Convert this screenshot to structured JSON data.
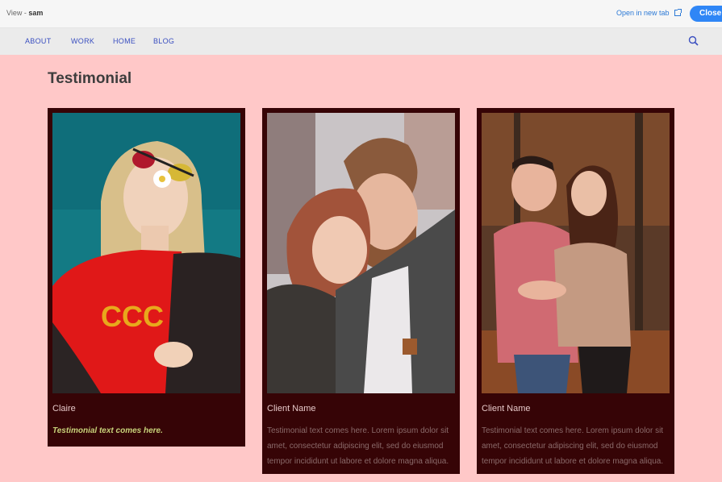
{
  "topbar": {
    "view_prefix": "View - ",
    "view_user": "sam",
    "open_new_tab": "Open in new tab",
    "close": "Close"
  },
  "nav": {
    "items": [
      "ABOUT",
      "WORK",
      "HOME",
      "BLOG"
    ]
  },
  "page": {
    "title": "Testimonial"
  },
  "cards": [
    {
      "name": "Claire",
      "text": "Testimonial text comes here.",
      "photo": "woman-sunglasses-flower-photo"
    },
    {
      "name": "Client Name",
      "text": "Testimonial text comes here. Lorem ipsum dolor sit amet, consectetur adipiscing elit, sed do eiusmod tempor incididunt ut labore et dolore magna aliqua.",
      "photo": "couple-embrace-photo"
    },
    {
      "name": "Client Name",
      "text": "Testimonial text comes here. Lorem ipsum dolor sit amet, consectetur adipiscing elit, sed do eiusmod tempor incididunt ut labore et dolore magna aliqua.",
      "photo": "couple-laughing-forest-photo"
    }
  ],
  "colors": {
    "page_bg": "#ffc8c8",
    "card_bg": "#360406",
    "accent": "#2f86f6",
    "nav_link": "#3a4fc0"
  }
}
